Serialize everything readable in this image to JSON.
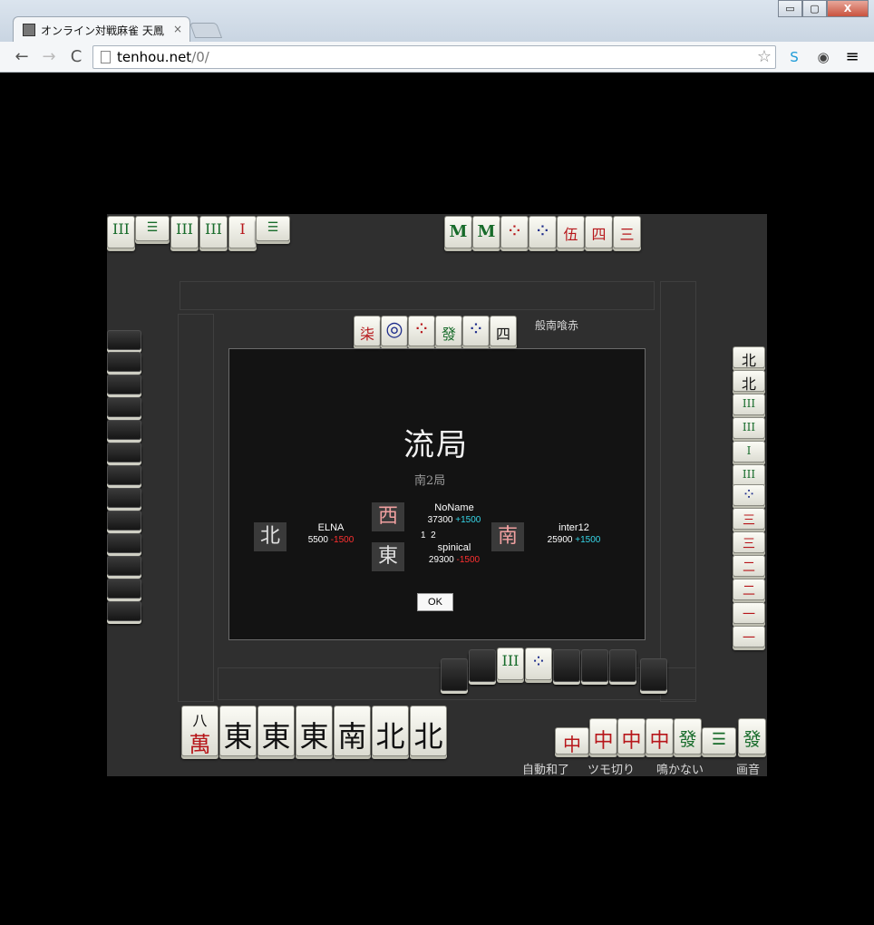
{
  "browser": {
    "tab_title": "オンライン対戦麻雀 天鳳",
    "tab_close": "×",
    "url_host": "tenhou.net",
    "url_path": "/0/",
    "back": "←",
    "forward": "→",
    "reload": "C",
    "minimize": "▭",
    "maximize": "▢",
    "close": "X",
    "star": "☆",
    "menu": "≡"
  },
  "game": {
    "rules_label": "般南喰赤",
    "result_title": "流局",
    "round_label": "南2局",
    "ok_label": "OK",
    "honba_counter": "1  2",
    "status_bar": [
      "自動和了",
      "ツモ切り",
      "鳴かない",
      "画音"
    ],
    "players": {
      "top": {
        "wind": "西",
        "name": "NoName",
        "score": "37300",
        "delta": "+1500"
      },
      "left": {
        "wind": "北",
        "name": "ELNA",
        "score": "5500",
        "delta": "-1500"
      },
      "right": {
        "wind": "南",
        "name": "inter12",
        "score": "25900",
        "delta": "+1500"
      },
      "bottom": {
        "wind": "東",
        "name": "spinical",
        "score": "29300",
        "delta": "-1500"
      }
    },
    "hand_tiles": [
      "八",
      "萬",
      "東",
      "東",
      "東",
      "南",
      "北",
      "北"
    ],
    "called_tiles": [
      "中",
      "中",
      "中",
      "中",
      "發",
      "發"
    ],
    "top_left_meld": [
      "III",
      "III",
      "III",
      "III",
      "I",
      "III"
    ],
    "top_right_meld": [
      "M",
      "M",
      "⁘",
      "⁘",
      "伍",
      "四",
      "三"
    ],
    "discard_top_row": [
      "柒",
      "◎",
      "⁘",
      "發",
      "⁘",
      "四"
    ],
    "right_column": [
      "北",
      "北",
      "III",
      "III",
      "I",
      "III",
      "⁘",
      "三",
      "三",
      "二",
      "二",
      "一"
    ]
  },
  "colors": {
    "board": "#2f2f2f",
    "plus": "#36d6e8",
    "minus": "#ff3030"
  }
}
